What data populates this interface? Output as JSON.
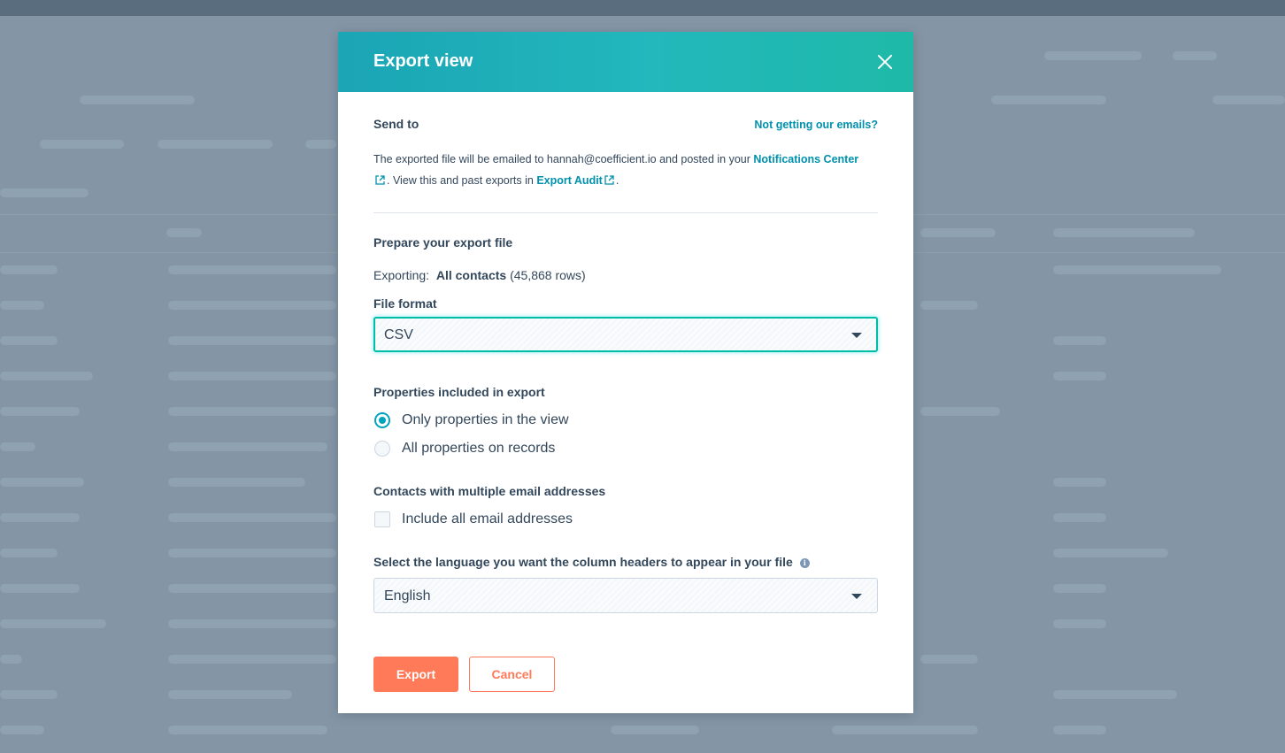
{
  "modal": {
    "title": "Export view",
    "send_to": {
      "heading": "Send to",
      "help_link": "Not getting our emails?",
      "text_before": "The exported file will be emailed to hannah@coefficient.io and posted in your ",
      "notifications_link": "Notifications Center",
      "text_middle": ". View this and past exports in ",
      "audit_link": "Export Audit",
      "text_end": "."
    },
    "prepare": {
      "heading": "Prepare your export file",
      "exporting_label": "Exporting:",
      "exporting_view": "All contacts",
      "exporting_rows": "(45,868 rows)"
    },
    "file_format": {
      "label": "File format",
      "value": "CSV"
    },
    "properties": {
      "heading": "Properties included in export",
      "options": [
        {
          "label": "Only properties in the view",
          "checked": true
        },
        {
          "label": "All properties on records",
          "checked": false
        }
      ]
    },
    "multiple_emails": {
      "heading": "Contacts with multiple email addresses",
      "checkbox_label": "Include all email addresses",
      "checked": false
    },
    "language": {
      "label": "Select the language you want the column headers to appear in your file",
      "value": "English"
    },
    "buttons": {
      "export": "Export",
      "cancel": "Cancel"
    }
  },
  "colors": {
    "header_gradient_start": "#1ba5b5",
    "header_gradient_end": "#1fb9a8",
    "primary_button": "#ff7a59",
    "link": "#0091ae",
    "radio_accent": "#00a4bd"
  }
}
